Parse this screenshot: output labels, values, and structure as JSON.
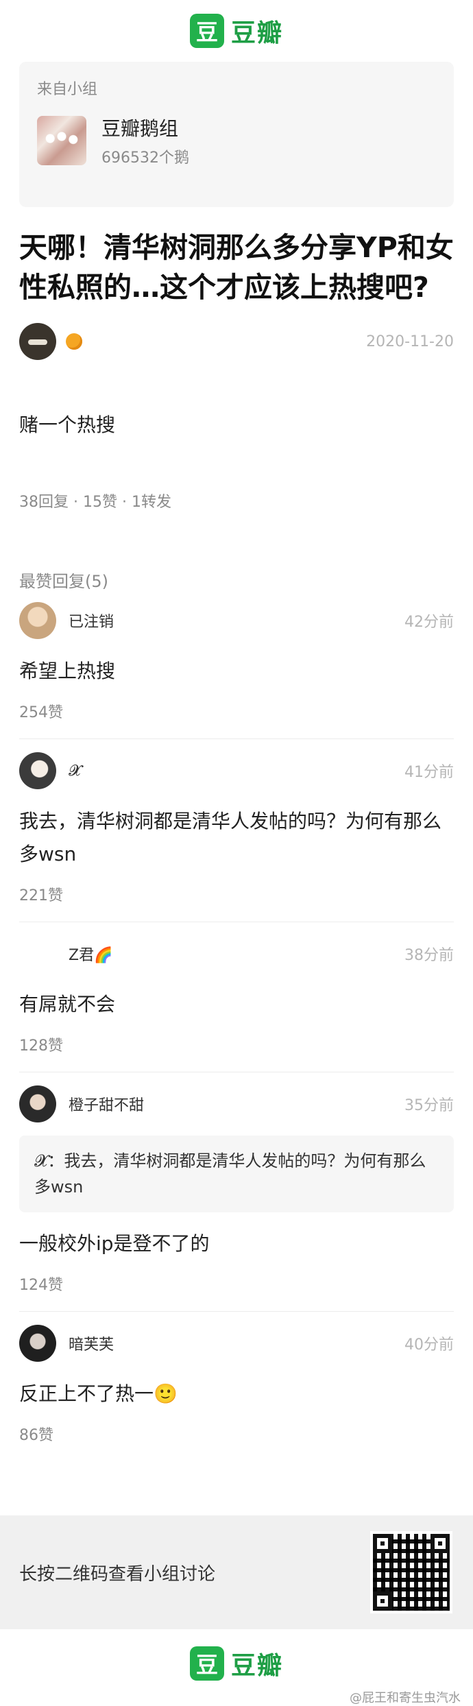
{
  "brand": {
    "logo_char": "豆",
    "name": "豆瓣"
  },
  "group": {
    "from_label": "来自小组",
    "name": "豆瓣鹅组",
    "members": "696532个鹅"
  },
  "post": {
    "title": "天哪！清华树洞那么多分享YP和女性私照的…这个才应该上热搜吧?",
    "date": "2020-11-20",
    "body": "赌一个热搜",
    "stats": "38回复 · 15赞 · 1转发"
  },
  "replies": {
    "section_label": "最赞回复(5)",
    "items": [
      {
        "name": "已注销",
        "time": "42分前",
        "text": "希望上热搜",
        "likes": "254赞"
      },
      {
        "name": "𝓧",
        "time": "41分前",
        "text": "我去，清华树洞都是清华人发帖的吗？为何有那么多wsn",
        "likes": "221赞"
      },
      {
        "name": "Z君🌈",
        "time": "38分前",
        "text": "有屌就不会",
        "likes": "128赞"
      },
      {
        "name": "橙子甜不甜",
        "time": "35分前",
        "quote": "𝓧：我去，清华树洞都是清华人发帖的吗？为何有那么多wsn",
        "text": "一般校外ip是登不了的",
        "likes": "124赞"
      },
      {
        "name": "暗芙芙",
        "time": "40分前",
        "text": "反正上不了热一🙂",
        "likes": "86赞"
      }
    ]
  },
  "footer": {
    "qr_text": "长按二维码查看小组讨论",
    "credit": "@屁王和寄生虫汽水"
  },
  "colors": {
    "brand_green": "#22b14c",
    "muted": "#8a8a8a"
  }
}
